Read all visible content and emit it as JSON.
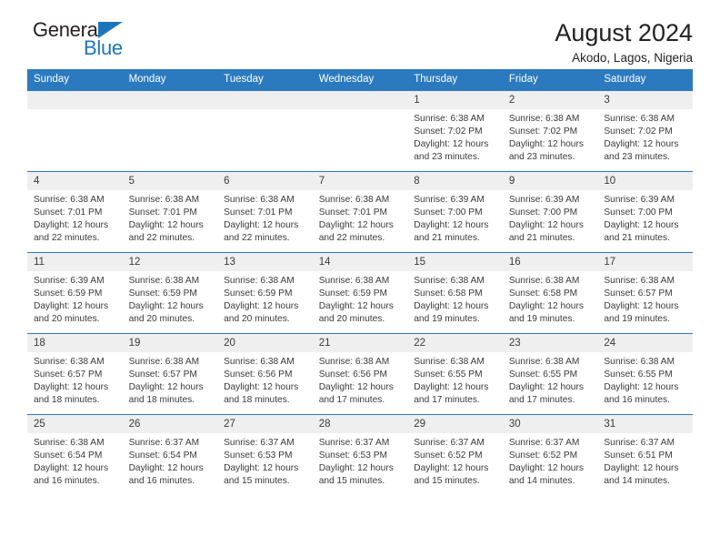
{
  "brand": {
    "name_top": "General",
    "name_bottom": "Blue",
    "accent_color": "#1b75bb"
  },
  "header": {
    "title": "August 2024",
    "location": "Akodo, Lagos, Nigeria"
  },
  "theme": {
    "header_bar_color": "#2b7ac0",
    "daynum_band_color": "#efefef",
    "text_color": "#3a3a3a"
  },
  "weekday_headers": [
    "Sunday",
    "Monday",
    "Tuesday",
    "Wednesday",
    "Thursday",
    "Friday",
    "Saturday"
  ],
  "weeks": [
    [
      {
        "day": "",
        "empty": true
      },
      {
        "day": "",
        "empty": true
      },
      {
        "day": "",
        "empty": true
      },
      {
        "day": "",
        "empty": true
      },
      {
        "day": "1",
        "sunrise": "Sunrise: 6:38 AM",
        "sunset": "Sunset: 7:02 PM",
        "daylight_line1": "Daylight: 12 hours",
        "daylight_line2": "and 23 minutes."
      },
      {
        "day": "2",
        "sunrise": "Sunrise: 6:38 AM",
        "sunset": "Sunset: 7:02 PM",
        "daylight_line1": "Daylight: 12 hours",
        "daylight_line2": "and 23 minutes."
      },
      {
        "day": "3",
        "sunrise": "Sunrise: 6:38 AM",
        "sunset": "Sunset: 7:02 PM",
        "daylight_line1": "Daylight: 12 hours",
        "daylight_line2": "and 23 minutes."
      }
    ],
    [
      {
        "day": "4",
        "sunrise": "Sunrise: 6:38 AM",
        "sunset": "Sunset: 7:01 PM",
        "daylight_line1": "Daylight: 12 hours",
        "daylight_line2": "and 22 minutes."
      },
      {
        "day": "5",
        "sunrise": "Sunrise: 6:38 AM",
        "sunset": "Sunset: 7:01 PM",
        "daylight_line1": "Daylight: 12 hours",
        "daylight_line2": "and 22 minutes."
      },
      {
        "day": "6",
        "sunrise": "Sunrise: 6:38 AM",
        "sunset": "Sunset: 7:01 PM",
        "daylight_line1": "Daylight: 12 hours",
        "daylight_line2": "and 22 minutes."
      },
      {
        "day": "7",
        "sunrise": "Sunrise: 6:38 AM",
        "sunset": "Sunset: 7:01 PM",
        "daylight_line1": "Daylight: 12 hours",
        "daylight_line2": "and 22 minutes."
      },
      {
        "day": "8",
        "sunrise": "Sunrise: 6:39 AM",
        "sunset": "Sunset: 7:00 PM",
        "daylight_line1": "Daylight: 12 hours",
        "daylight_line2": "and 21 minutes."
      },
      {
        "day": "9",
        "sunrise": "Sunrise: 6:39 AM",
        "sunset": "Sunset: 7:00 PM",
        "daylight_line1": "Daylight: 12 hours",
        "daylight_line2": "and 21 minutes."
      },
      {
        "day": "10",
        "sunrise": "Sunrise: 6:39 AM",
        "sunset": "Sunset: 7:00 PM",
        "daylight_line1": "Daylight: 12 hours",
        "daylight_line2": "and 21 minutes."
      }
    ],
    [
      {
        "day": "11",
        "sunrise": "Sunrise: 6:39 AM",
        "sunset": "Sunset: 6:59 PM",
        "daylight_line1": "Daylight: 12 hours",
        "daylight_line2": "and 20 minutes."
      },
      {
        "day": "12",
        "sunrise": "Sunrise: 6:38 AM",
        "sunset": "Sunset: 6:59 PM",
        "daylight_line1": "Daylight: 12 hours",
        "daylight_line2": "and 20 minutes."
      },
      {
        "day": "13",
        "sunrise": "Sunrise: 6:38 AM",
        "sunset": "Sunset: 6:59 PM",
        "daylight_line1": "Daylight: 12 hours",
        "daylight_line2": "and 20 minutes."
      },
      {
        "day": "14",
        "sunrise": "Sunrise: 6:38 AM",
        "sunset": "Sunset: 6:59 PM",
        "daylight_line1": "Daylight: 12 hours",
        "daylight_line2": "and 20 minutes."
      },
      {
        "day": "15",
        "sunrise": "Sunrise: 6:38 AM",
        "sunset": "Sunset: 6:58 PM",
        "daylight_line1": "Daylight: 12 hours",
        "daylight_line2": "and 19 minutes."
      },
      {
        "day": "16",
        "sunrise": "Sunrise: 6:38 AM",
        "sunset": "Sunset: 6:58 PM",
        "daylight_line1": "Daylight: 12 hours",
        "daylight_line2": "and 19 minutes."
      },
      {
        "day": "17",
        "sunrise": "Sunrise: 6:38 AM",
        "sunset": "Sunset: 6:57 PM",
        "daylight_line1": "Daylight: 12 hours",
        "daylight_line2": "and 19 minutes."
      }
    ],
    [
      {
        "day": "18",
        "sunrise": "Sunrise: 6:38 AM",
        "sunset": "Sunset: 6:57 PM",
        "daylight_line1": "Daylight: 12 hours",
        "daylight_line2": "and 18 minutes."
      },
      {
        "day": "19",
        "sunrise": "Sunrise: 6:38 AM",
        "sunset": "Sunset: 6:57 PM",
        "daylight_line1": "Daylight: 12 hours",
        "daylight_line2": "and 18 minutes."
      },
      {
        "day": "20",
        "sunrise": "Sunrise: 6:38 AM",
        "sunset": "Sunset: 6:56 PM",
        "daylight_line1": "Daylight: 12 hours",
        "daylight_line2": "and 18 minutes."
      },
      {
        "day": "21",
        "sunrise": "Sunrise: 6:38 AM",
        "sunset": "Sunset: 6:56 PM",
        "daylight_line1": "Daylight: 12 hours",
        "daylight_line2": "and 17 minutes."
      },
      {
        "day": "22",
        "sunrise": "Sunrise: 6:38 AM",
        "sunset": "Sunset: 6:55 PM",
        "daylight_line1": "Daylight: 12 hours",
        "daylight_line2": "and 17 minutes."
      },
      {
        "day": "23",
        "sunrise": "Sunrise: 6:38 AM",
        "sunset": "Sunset: 6:55 PM",
        "daylight_line1": "Daylight: 12 hours",
        "daylight_line2": "and 17 minutes."
      },
      {
        "day": "24",
        "sunrise": "Sunrise: 6:38 AM",
        "sunset": "Sunset: 6:55 PM",
        "daylight_line1": "Daylight: 12 hours",
        "daylight_line2": "and 16 minutes."
      }
    ],
    [
      {
        "day": "25",
        "sunrise": "Sunrise: 6:38 AM",
        "sunset": "Sunset: 6:54 PM",
        "daylight_line1": "Daylight: 12 hours",
        "daylight_line2": "and 16 minutes."
      },
      {
        "day": "26",
        "sunrise": "Sunrise: 6:37 AM",
        "sunset": "Sunset: 6:54 PM",
        "daylight_line1": "Daylight: 12 hours",
        "daylight_line2": "and 16 minutes."
      },
      {
        "day": "27",
        "sunrise": "Sunrise: 6:37 AM",
        "sunset": "Sunset: 6:53 PM",
        "daylight_line1": "Daylight: 12 hours",
        "daylight_line2": "and 15 minutes."
      },
      {
        "day": "28",
        "sunrise": "Sunrise: 6:37 AM",
        "sunset": "Sunset: 6:53 PM",
        "daylight_line1": "Daylight: 12 hours",
        "daylight_line2": "and 15 minutes."
      },
      {
        "day": "29",
        "sunrise": "Sunrise: 6:37 AM",
        "sunset": "Sunset: 6:52 PM",
        "daylight_line1": "Daylight: 12 hours",
        "daylight_line2": "and 15 minutes."
      },
      {
        "day": "30",
        "sunrise": "Sunrise: 6:37 AM",
        "sunset": "Sunset: 6:52 PM",
        "daylight_line1": "Daylight: 12 hours",
        "daylight_line2": "and 14 minutes."
      },
      {
        "day": "31",
        "sunrise": "Sunrise: 6:37 AM",
        "sunset": "Sunset: 6:51 PM",
        "daylight_line1": "Daylight: 12 hours",
        "daylight_line2": "and 14 minutes."
      }
    ]
  ]
}
